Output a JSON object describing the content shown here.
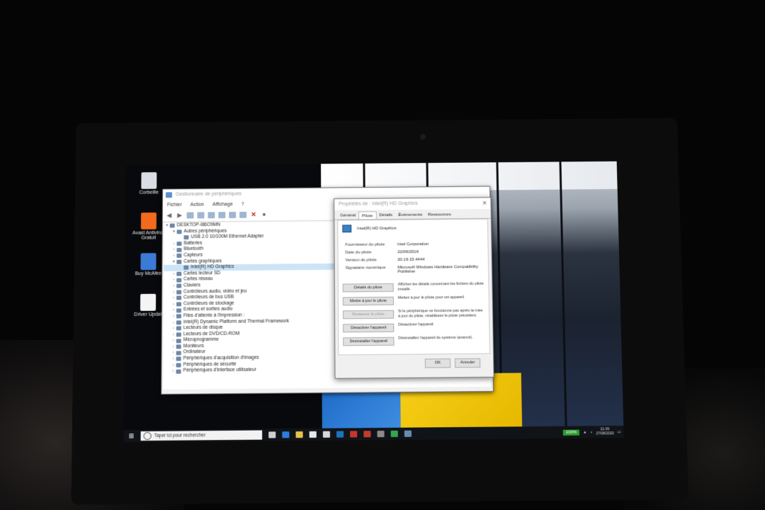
{
  "desktop": {
    "icons": [
      {
        "label": "Corbeille",
        "icon": "recycle-bin-icon",
        "color": "#d9dde3"
      },
      {
        "label": "Avast Antivirus Gratuit",
        "icon": "avast-icon",
        "color": "#f26a1b"
      },
      {
        "label": "Buy McAfee",
        "icon": "mcafee-icon",
        "color": "#3a7bd5"
      },
      {
        "label": "Driver Updat",
        "icon": "document-icon",
        "color": "#f4f4f4"
      }
    ]
  },
  "device_manager": {
    "title": "Gestionnaire de périphériques",
    "menu": [
      "Fichier",
      "Action",
      "Affichage",
      "?"
    ],
    "tree": [
      {
        "label": "DESKTOP-I86O9MN",
        "level": 0,
        "expanded": true
      },
      {
        "label": "Autres périphériques",
        "level": 1,
        "expanded": true
      },
      {
        "label": "USB 2.0 10/100M Ethernet Adapter",
        "level": 2
      },
      {
        "label": "Batteries",
        "level": 1
      },
      {
        "label": "Bluetooth",
        "level": 1
      },
      {
        "label": "Capteurs",
        "level": 1
      },
      {
        "label": "Cartes graphiques",
        "level": 1,
        "expanded": true
      },
      {
        "label": "Intel(R) HD Graphics",
        "level": 2,
        "selected": true
      },
      {
        "label": "Cartes lecteur SD",
        "level": 1
      },
      {
        "label": "Cartes réseau",
        "level": 1
      },
      {
        "label": "Claviers",
        "level": 1
      },
      {
        "label": "Contrôleurs audio, vidéo et jeu",
        "level": 1
      },
      {
        "label": "Contrôleurs de bus USB",
        "level": 1
      },
      {
        "label": "Contrôleurs de stockage",
        "level": 1
      },
      {
        "label": "Entrées et sorties audio",
        "level": 1
      },
      {
        "label": "Files d'attente à l'impression :",
        "level": 1
      },
      {
        "label": "Intel(R) Dynamic Platform and Thermal Framework",
        "level": 1
      },
      {
        "label": "Lecteurs de disque",
        "level": 1
      },
      {
        "label": "Lecteurs de DVD/CD-ROM",
        "level": 1
      },
      {
        "label": "Microprogramme",
        "level": 1
      },
      {
        "label": "Moniteurs",
        "level": 1
      },
      {
        "label": "Ordinateur",
        "level": 1
      },
      {
        "label": "Périphériques d'acquisition d'images",
        "level": 1
      },
      {
        "label": "Périphériques de sécurité",
        "level": 1
      },
      {
        "label": "Périphériques d'interface utilisateur",
        "level": 1
      }
    ]
  },
  "properties": {
    "title": "Propriétés de : Intel(R) HD Graphics",
    "tabs": [
      "Général",
      "Pilote",
      "Détails",
      "Événements",
      "Ressources"
    ],
    "active_tab": "Pilote",
    "device_name": "Intel(R) HD Graphics",
    "fields": [
      {
        "key": "Fournisseur du pilote",
        "value": "Intel Corporation"
      },
      {
        "key": "Date du pilote",
        "value": "22/06/2016"
      },
      {
        "key": "Version du pilote",
        "value": "20.19.15.4444"
      },
      {
        "key": "Signataire numérique",
        "value": "Microsoft Windows Hardware Compatibility Publisher"
      }
    ],
    "actions": [
      {
        "label": "Détails du pilote",
        "desc": "Affichez les détails concernant les fichiers du pilote installé.",
        "enabled": true
      },
      {
        "label": "Mettre à jour le pilote",
        "desc": "Mettez à jour le pilote pour cet appareil.",
        "enabled": true
      },
      {
        "label": "Restaurer le pilote",
        "desc": "Si le périphérique ne fonctionne pas après la mise à jour du pilote, rétablissez le pilote précédent.",
        "enabled": false
      },
      {
        "label": "Désactiver l'appareil",
        "desc": "Désactivez l'appareil.",
        "enabled": true
      },
      {
        "label": "Désinstaller l'appareil",
        "desc": "Désinstallez l'appareil du système (avancé).",
        "enabled": true
      }
    ],
    "ok_label": "OK",
    "cancel_label": "Annuler"
  },
  "taskbar": {
    "search_placeholder": "Taper ici pour rechercher",
    "apps": [
      {
        "icon": "task-view-icon",
        "color": "#cfcfcf"
      },
      {
        "icon": "edge-icon",
        "color": "#2d7de0"
      },
      {
        "icon": "explorer-icon",
        "color": "#e8c34a"
      },
      {
        "icon": "store-icon",
        "color": "#e8e8e8"
      },
      {
        "icon": "mail-icon",
        "color": "#d8d8d8"
      },
      {
        "icon": "app-icon",
        "color": "#1e73be"
      },
      {
        "icon": "app-red-icon",
        "color": "#c8352d"
      },
      {
        "icon": "app-icon-2",
        "color": "#c43b2e"
      },
      {
        "icon": "app-icon-3",
        "color": "#8a8a8a"
      },
      {
        "icon": "chrome-icon",
        "color": "#33a852"
      },
      {
        "icon": "device-manager-icon",
        "color": "#6a8cb0"
      }
    ],
    "battery": "100%",
    "time": "21:09",
    "date": "27/08/2020"
  }
}
